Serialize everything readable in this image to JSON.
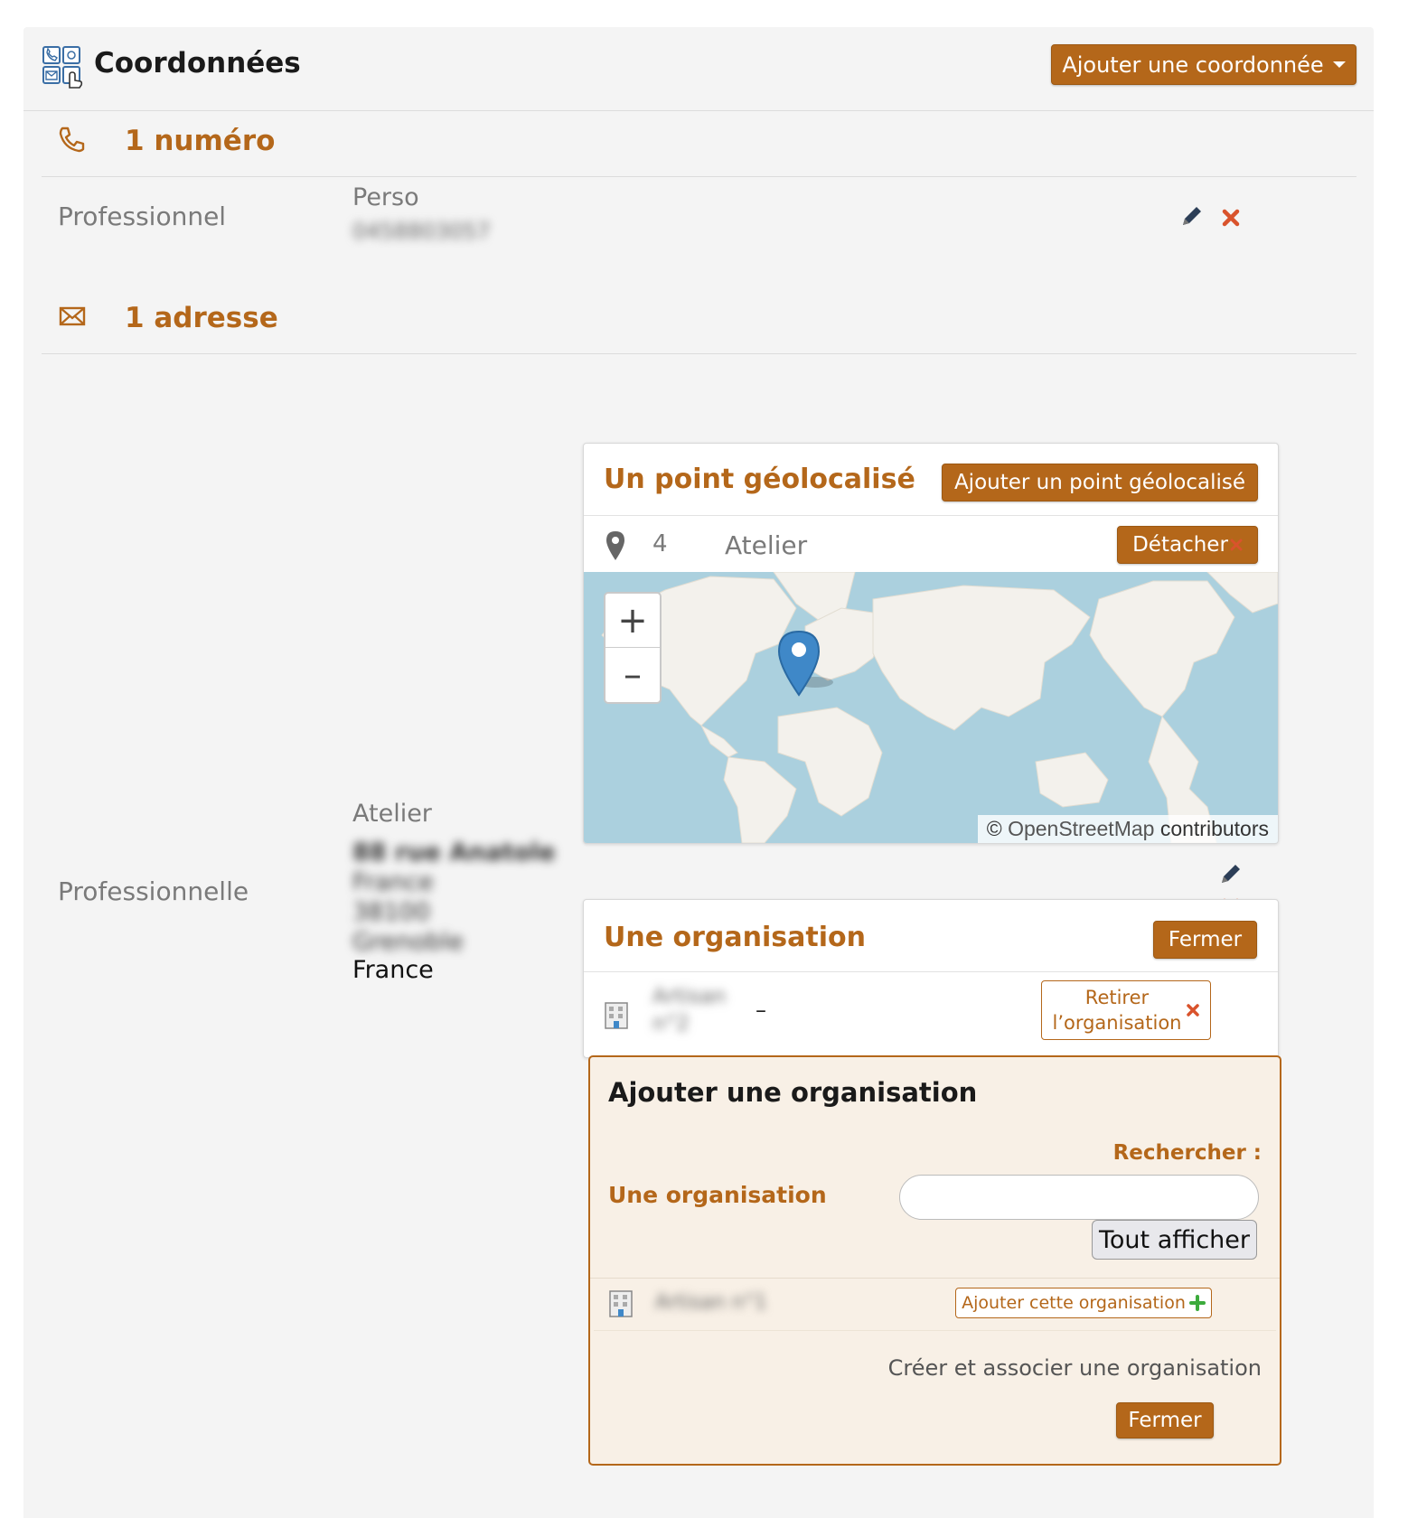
{
  "header": {
    "title": "Coordonnées",
    "add_button_label": "Ajouter une coordonnée"
  },
  "phones": {
    "section_title": "1 numéro",
    "items": [
      {
        "label": "Professionnel",
        "type": "Perso",
        "number": "0458803057"
      }
    ]
  },
  "addresses": {
    "section_title": "1 adresse",
    "items": [
      {
        "label": "Professionnelle",
        "type": "Atelier",
        "line1": "88 rue Anatole",
        "line2": "France",
        "postcode": "38100",
        "city": "Grenoble",
        "country": "France"
      }
    ]
  },
  "geo": {
    "title": "Un point géolocalisé",
    "add_button_label": "Ajouter un point géolocalisé",
    "point_number": "4",
    "point_name": "Atelier",
    "detach_label": "Détacher",
    "zoom_in": "+",
    "zoom_out": "–",
    "attribution_copyright": "©",
    "attribution_osm": "OpenStreetMap",
    "attribution_suffix": "contributors"
  },
  "organisation": {
    "title": "Une organisation",
    "close_label": "Fermer",
    "linked_name_line1": "Artisan",
    "linked_name_line2": "n°2",
    "linked_dash": "–",
    "remove_label_line1": "Retirer",
    "remove_label_line2": "l’organisation"
  },
  "add_organisation": {
    "title": "Ajouter une organisation",
    "search_label": "Rechercher :",
    "field_label": "Une organisation",
    "search_value": "",
    "show_all_label": "Tout afficher",
    "result_name": "Artisan n°1",
    "add_this_label": "Ajouter cette organisation",
    "create_link_label": "Créer et associer une organisation",
    "close_label": "Fermer"
  },
  "colors": {
    "accent": "#b4671a",
    "delete": "#d9532c",
    "add": "#3cab3c",
    "panel_bg": "#f4f4f4",
    "map_water": "#abd0de",
    "map_land": "#f3f1ec",
    "marker": "#3f88c8"
  },
  "icons": {
    "header": "contact-cards-icon",
    "phone": "phone-icon",
    "envelope": "envelope-icon",
    "edit": "pencil-icon",
    "delete": "close-x-icon",
    "map_pin": "map-pin-icon",
    "building": "building-icon",
    "plus": "plus-icon"
  }
}
